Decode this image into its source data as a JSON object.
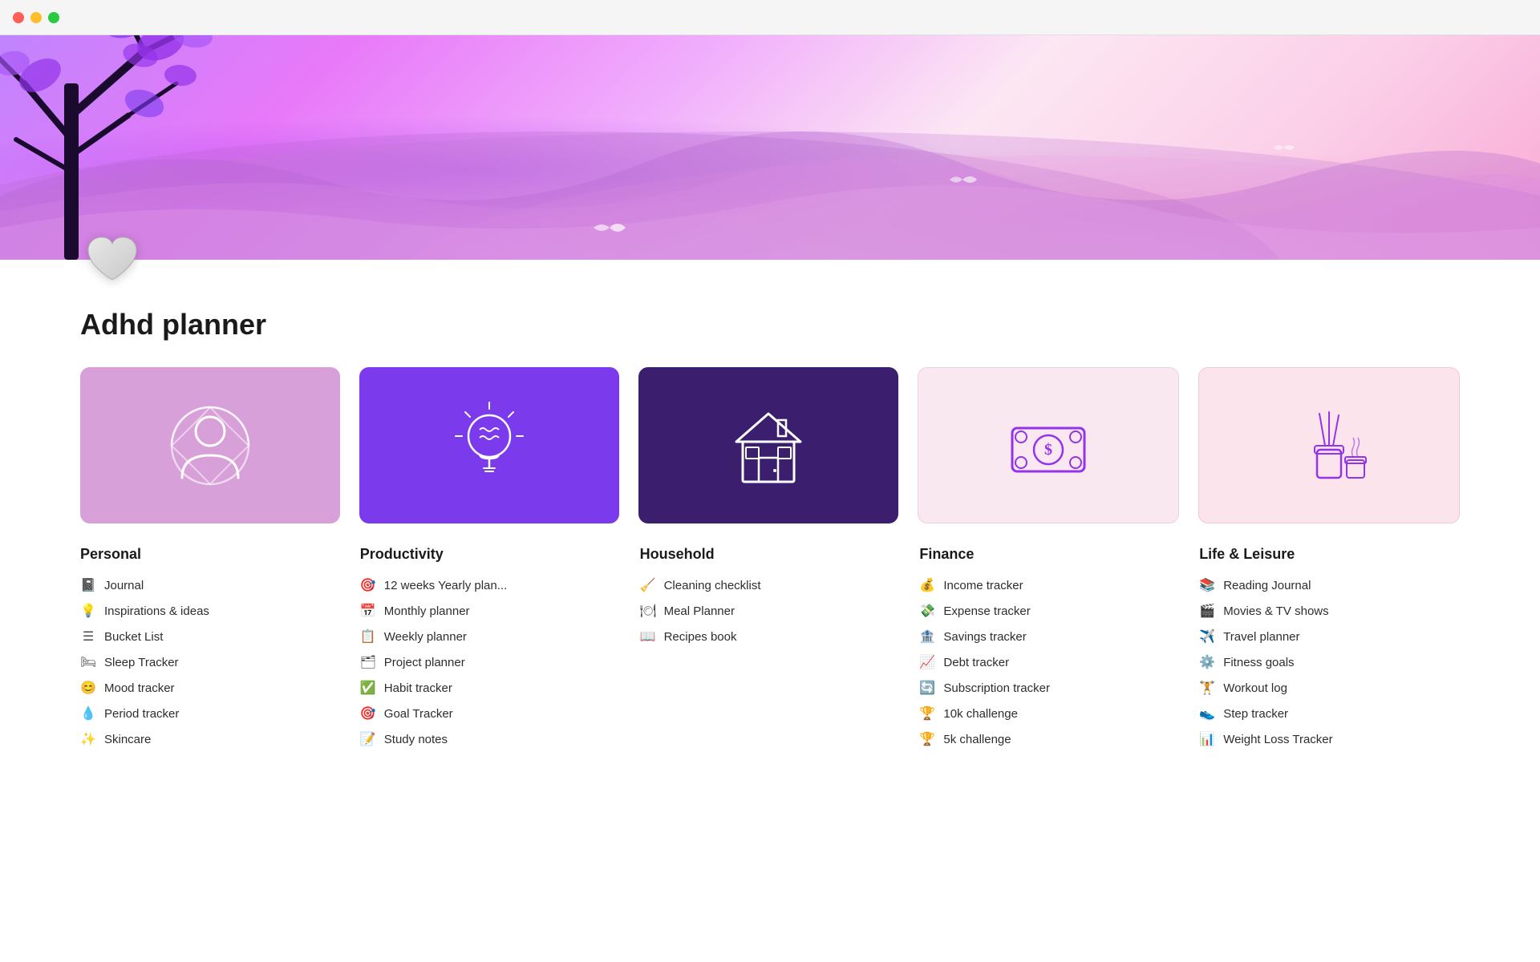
{
  "titlebar": {
    "buttons": [
      "close",
      "minimize",
      "maximize"
    ]
  },
  "page": {
    "title": "Adhd planner"
  },
  "cards": [
    {
      "id": "personal",
      "color_class": "card-personal",
      "icon": "person"
    },
    {
      "id": "productivity",
      "color_class": "card-productivity",
      "icon": "brain"
    },
    {
      "id": "household",
      "color_class": "card-household",
      "icon": "house"
    },
    {
      "id": "finance",
      "color_class": "card-finance",
      "icon": "money"
    },
    {
      "id": "leisure",
      "color_class": "card-leisure",
      "icon": "candle"
    }
  ],
  "categories": [
    {
      "id": "personal",
      "title": "Personal",
      "items": [
        {
          "label": "Journal",
          "icon": "📓"
        },
        {
          "label": "Inspirations & ideas",
          "icon": "💡"
        },
        {
          "label": "Bucket List",
          "icon": "☰"
        },
        {
          "label": "Sleep Tracker",
          "icon": "🛏"
        },
        {
          "label": "Mood tracker",
          "icon": "😊"
        },
        {
          "label": "Period tracker",
          "icon": "💧"
        },
        {
          "label": "Skincare",
          "icon": "✨"
        }
      ]
    },
    {
      "id": "productivity",
      "title": "Productivity",
      "items": [
        {
          "label": "12 weeks Yearly plan...",
          "icon": "🎯"
        },
        {
          "label": "Monthly planner",
          "icon": "📅"
        },
        {
          "label": "Weekly planner",
          "icon": "📋"
        },
        {
          "label": "Project planner",
          "icon": "🗂"
        },
        {
          "label": "Habit tracker",
          "icon": "✅"
        },
        {
          "label": "Goal Tracker",
          "icon": "🎯"
        },
        {
          "label": "Study notes",
          "icon": "📝"
        }
      ]
    },
    {
      "id": "household",
      "title": "Household",
      "items": [
        {
          "label": "Cleaning checklist",
          "icon": "🧹"
        },
        {
          "label": "Meal Planner",
          "icon": "🍽"
        },
        {
          "label": "Recipes book",
          "icon": "📖"
        }
      ]
    },
    {
      "id": "finance",
      "title": "Finance",
      "items": [
        {
          "label": "Income tracker",
          "icon": "💰"
        },
        {
          "label": "Expense tracker",
          "icon": "💸"
        },
        {
          "label": "Savings tracker",
          "icon": "🏦"
        },
        {
          "label": "Debt tracker",
          "icon": "📈"
        },
        {
          "label": "Subscription tracker",
          "icon": "🔄"
        },
        {
          "label": "10k challenge",
          "icon": "🏆"
        },
        {
          "label": "5k challenge",
          "icon": "🏆"
        }
      ]
    },
    {
      "id": "leisure",
      "title": "Life & Leisure",
      "items": [
        {
          "label": "Reading Journal",
          "icon": "📚"
        },
        {
          "label": "Movies & TV shows",
          "icon": "🎬"
        },
        {
          "label": "Travel planner",
          "icon": "✈️"
        },
        {
          "label": "Fitness goals",
          "icon": "⚙️"
        },
        {
          "label": "Workout log",
          "icon": "🏋"
        },
        {
          "label": "Step tracker",
          "icon": "👟"
        },
        {
          "label": "Weight Loss Tracker",
          "icon": "📊"
        }
      ]
    }
  ]
}
